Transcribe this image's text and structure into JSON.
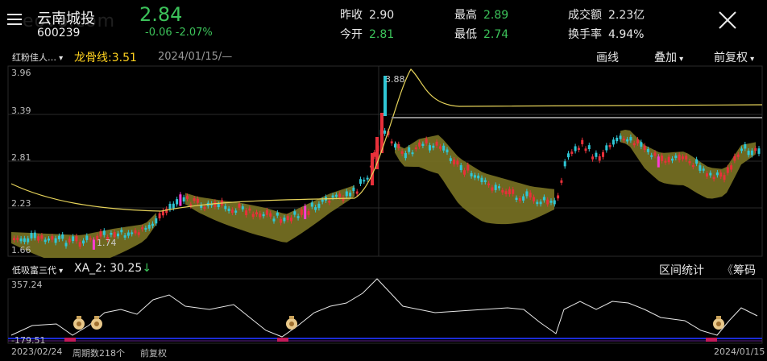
{
  "header": {
    "name": "云南城投",
    "code": "600239",
    "price": "2.84",
    "change": "-0.06",
    "change_pct": "-2.07%",
    "watermark": "eovo.com",
    "quotes": [
      {
        "label": "昨收",
        "value": "2.90",
        "color": "#e8e8e8"
      },
      {
        "label": "今开",
        "value": "2.81",
        "color": "#3cc35a"
      },
      {
        "label": "最高",
        "value": "2.89",
        "color": "#3cc35a"
      },
      {
        "label": "最低",
        "value": "2.74",
        "color": "#3cc35a"
      },
      {
        "label": "成交额",
        "value": "2.23亿",
        "color": "#e8e8e8"
      },
      {
        "label": "换手率",
        "value": "4.94%",
        "color": "#e8e8e8"
      }
    ]
  },
  "main_chart": {
    "indicator_select": "红粉佳人…",
    "indicator_line": "龙骨线:3.51",
    "date": "2024/01/15/—",
    "tools": [
      "画线",
      "叠加",
      "前复权"
    ],
    "price_labels": [
      "3.96",
      "3.39",
      "2.81",
      "2.23",
      "1.66"
    ],
    "high_marker": "3.88",
    "low_marker": "1.74"
  },
  "sub_chart": {
    "indicator_select": "低吸富三代",
    "value_label": "XA_2: 30.25",
    "arrow": "↓",
    "stats_button": "区间统计",
    "chips_button": "筹码",
    "chips_prefix": "《",
    "top_label": "357.24",
    "bottom_label": "-179.51"
  },
  "footer": {
    "start_date": "2023/02/24",
    "period_count": "周期数218个",
    "adjust": "前复权",
    "end_date": "2024/01/15"
  },
  "colors": {
    "up": "#e8303a",
    "down": "#2fc7d6",
    "cloud": "#7a7324",
    "ma": "#e6d35a",
    "magenta": "#ff3bd4",
    "yellow_candle": "#ffe400"
  }
}
